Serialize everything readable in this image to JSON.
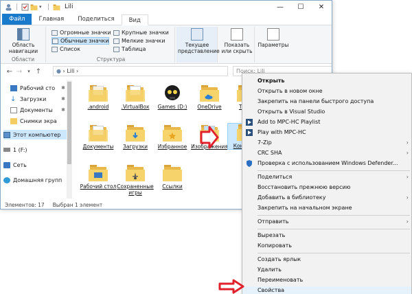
{
  "window": {
    "title": "Lili",
    "controls": {
      "minimize": "—",
      "maximize": "☐",
      "close": "✕"
    }
  },
  "ribbon": {
    "tabs": [
      "Файл",
      "Главная",
      "Поделиться",
      "Вид"
    ],
    "groups": {
      "areas": {
        "label": "Области",
        "nav_button": "Область навигации"
      },
      "structure": {
        "label": "Структура",
        "items": [
          "Огромные значки",
          "Крупные значки",
          "Обычные значки",
          "Мелкие значки",
          "Список",
          "Таблица"
        ]
      },
      "current_view": {
        "label": "Текущее представление"
      },
      "show_hide": {
        "label": "Показать или скрыть"
      },
      "params": {
        "label": "Параметры"
      }
    }
  },
  "address": {
    "path_sep": "›",
    "path": "Lili",
    "search_placeholder": "Поиск: Lili"
  },
  "nav": {
    "items": [
      {
        "label": "Рабочий сто"
      },
      {
        "label": "Загрузки"
      },
      {
        "label": "Документы"
      },
      {
        "label": "Снимки экра"
      },
      {
        "label": "Этот компьютер"
      },
      {
        "label": "1 (F:)"
      },
      {
        "label": "Сеть"
      },
      {
        "label": "Домашняя групп"
      }
    ]
  },
  "files": [
    {
      "name": ".android"
    },
    {
      "name": ".VirtualBox"
    },
    {
      "name": "Games (D:)"
    },
    {
      "name": "OneDrive"
    },
    {
      "name": "Tracin"
    },
    {
      "name": "Документы"
    },
    {
      "name": "Загрузки"
    },
    {
      "name": "Избранное"
    },
    {
      "name": "Изображения"
    },
    {
      "name": "Контакты"
    },
    {
      "name": "Рабочий стол"
    },
    {
      "name": "Сохраненные игры"
    },
    {
      "name": "Ссылки"
    }
  ],
  "status": {
    "count": "Элементов: 17",
    "selected": "Выбран 1 элемент"
  },
  "context_menu": {
    "items": [
      {
        "label": "Открыть",
        "bold": true
      },
      {
        "label": "Открыть в новом окне"
      },
      {
        "label": "Закрепить на панели быстрого доступа"
      },
      {
        "label": "Открыть в Visual Studio"
      },
      {
        "label": "Add to MPC-HC Playlist"
      },
      {
        "label": "Play with MPC-HC"
      },
      {
        "label": "7-Zip",
        "submenu": true
      },
      {
        "label": "CRC SHA",
        "submenu": true
      },
      {
        "label": "Проверка с использованием Windows Defender..."
      },
      {
        "label": "Поделиться",
        "submenu": true
      },
      {
        "label": "Восстановить прежнюю версию"
      },
      {
        "label": "Добавить в библиотеку",
        "submenu": true
      },
      {
        "label": "Закрепить на начальном экране"
      },
      {
        "label": "Отправить",
        "submenu": true
      },
      {
        "label": "Вырезать"
      },
      {
        "label": "Копировать"
      },
      {
        "label": "Создать ярлык"
      },
      {
        "label": "Удалить"
      },
      {
        "label": "Переименовать"
      },
      {
        "label": "Свойства"
      }
    ]
  },
  "colors": {
    "accent": "#1979ca",
    "folder": "#f7d36b",
    "selection": "#cce8ff",
    "annotation_arrow": "#e0202a"
  }
}
